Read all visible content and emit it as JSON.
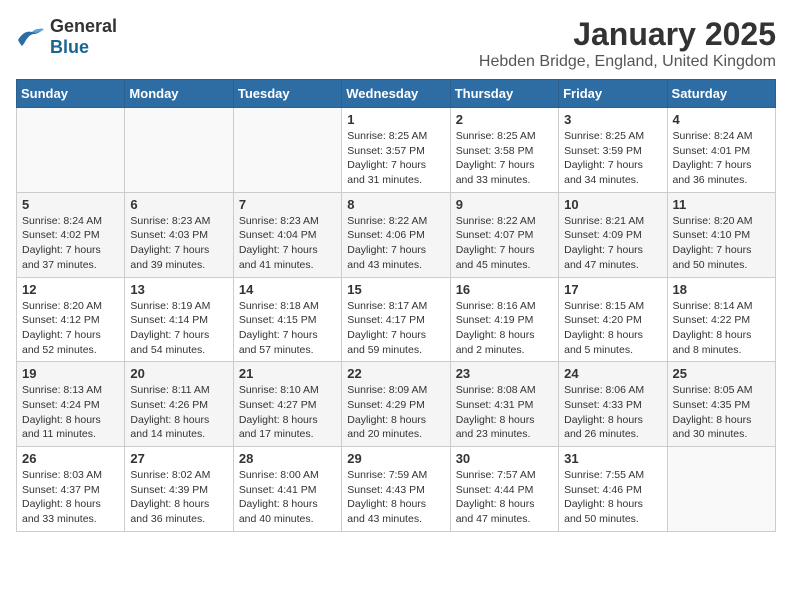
{
  "header": {
    "logo_general": "General",
    "logo_blue": "Blue",
    "month_year": "January 2025",
    "location": "Hebden Bridge, England, United Kingdom"
  },
  "calendar": {
    "days_of_week": [
      "Sunday",
      "Monday",
      "Tuesday",
      "Wednesday",
      "Thursday",
      "Friday",
      "Saturday"
    ],
    "weeks": [
      [
        {
          "day": "",
          "sunrise": "",
          "sunset": "",
          "daylight": ""
        },
        {
          "day": "",
          "sunrise": "",
          "sunset": "",
          "daylight": ""
        },
        {
          "day": "",
          "sunrise": "",
          "sunset": "",
          "daylight": ""
        },
        {
          "day": "1",
          "sunrise": "Sunrise: 8:25 AM",
          "sunset": "Sunset: 3:57 PM",
          "daylight": "Daylight: 7 hours and 31 minutes."
        },
        {
          "day": "2",
          "sunrise": "Sunrise: 8:25 AM",
          "sunset": "Sunset: 3:58 PM",
          "daylight": "Daylight: 7 hours and 33 minutes."
        },
        {
          "day": "3",
          "sunrise": "Sunrise: 8:25 AM",
          "sunset": "Sunset: 3:59 PM",
          "daylight": "Daylight: 7 hours and 34 minutes."
        },
        {
          "day": "4",
          "sunrise": "Sunrise: 8:24 AM",
          "sunset": "Sunset: 4:01 PM",
          "daylight": "Daylight: 7 hours and 36 minutes."
        }
      ],
      [
        {
          "day": "5",
          "sunrise": "Sunrise: 8:24 AM",
          "sunset": "Sunset: 4:02 PM",
          "daylight": "Daylight: 7 hours and 37 minutes."
        },
        {
          "day": "6",
          "sunrise": "Sunrise: 8:23 AM",
          "sunset": "Sunset: 4:03 PM",
          "daylight": "Daylight: 7 hours and 39 minutes."
        },
        {
          "day": "7",
          "sunrise": "Sunrise: 8:23 AM",
          "sunset": "Sunset: 4:04 PM",
          "daylight": "Daylight: 7 hours and 41 minutes."
        },
        {
          "day": "8",
          "sunrise": "Sunrise: 8:22 AM",
          "sunset": "Sunset: 4:06 PM",
          "daylight": "Daylight: 7 hours and 43 minutes."
        },
        {
          "day": "9",
          "sunrise": "Sunrise: 8:22 AM",
          "sunset": "Sunset: 4:07 PM",
          "daylight": "Daylight: 7 hours and 45 minutes."
        },
        {
          "day": "10",
          "sunrise": "Sunrise: 8:21 AM",
          "sunset": "Sunset: 4:09 PM",
          "daylight": "Daylight: 7 hours and 47 minutes."
        },
        {
          "day": "11",
          "sunrise": "Sunrise: 8:20 AM",
          "sunset": "Sunset: 4:10 PM",
          "daylight": "Daylight: 7 hours and 50 minutes."
        }
      ],
      [
        {
          "day": "12",
          "sunrise": "Sunrise: 8:20 AM",
          "sunset": "Sunset: 4:12 PM",
          "daylight": "Daylight: 7 hours and 52 minutes."
        },
        {
          "day": "13",
          "sunrise": "Sunrise: 8:19 AM",
          "sunset": "Sunset: 4:14 PM",
          "daylight": "Daylight: 7 hours and 54 minutes."
        },
        {
          "day": "14",
          "sunrise": "Sunrise: 8:18 AM",
          "sunset": "Sunset: 4:15 PM",
          "daylight": "Daylight: 7 hours and 57 minutes."
        },
        {
          "day": "15",
          "sunrise": "Sunrise: 8:17 AM",
          "sunset": "Sunset: 4:17 PM",
          "daylight": "Daylight: 7 hours and 59 minutes."
        },
        {
          "day": "16",
          "sunrise": "Sunrise: 8:16 AM",
          "sunset": "Sunset: 4:19 PM",
          "daylight": "Daylight: 8 hours and 2 minutes."
        },
        {
          "day": "17",
          "sunrise": "Sunrise: 8:15 AM",
          "sunset": "Sunset: 4:20 PM",
          "daylight": "Daylight: 8 hours and 5 minutes."
        },
        {
          "day": "18",
          "sunrise": "Sunrise: 8:14 AM",
          "sunset": "Sunset: 4:22 PM",
          "daylight": "Daylight: 8 hours and 8 minutes."
        }
      ],
      [
        {
          "day": "19",
          "sunrise": "Sunrise: 8:13 AM",
          "sunset": "Sunset: 4:24 PM",
          "daylight": "Daylight: 8 hours and 11 minutes."
        },
        {
          "day": "20",
          "sunrise": "Sunrise: 8:11 AM",
          "sunset": "Sunset: 4:26 PM",
          "daylight": "Daylight: 8 hours and 14 minutes."
        },
        {
          "day": "21",
          "sunrise": "Sunrise: 8:10 AM",
          "sunset": "Sunset: 4:27 PM",
          "daylight": "Daylight: 8 hours and 17 minutes."
        },
        {
          "day": "22",
          "sunrise": "Sunrise: 8:09 AM",
          "sunset": "Sunset: 4:29 PM",
          "daylight": "Daylight: 8 hours and 20 minutes."
        },
        {
          "day": "23",
          "sunrise": "Sunrise: 8:08 AM",
          "sunset": "Sunset: 4:31 PM",
          "daylight": "Daylight: 8 hours and 23 minutes."
        },
        {
          "day": "24",
          "sunrise": "Sunrise: 8:06 AM",
          "sunset": "Sunset: 4:33 PM",
          "daylight": "Daylight: 8 hours and 26 minutes."
        },
        {
          "day": "25",
          "sunrise": "Sunrise: 8:05 AM",
          "sunset": "Sunset: 4:35 PM",
          "daylight": "Daylight: 8 hours and 30 minutes."
        }
      ],
      [
        {
          "day": "26",
          "sunrise": "Sunrise: 8:03 AM",
          "sunset": "Sunset: 4:37 PM",
          "daylight": "Daylight: 8 hours and 33 minutes."
        },
        {
          "day": "27",
          "sunrise": "Sunrise: 8:02 AM",
          "sunset": "Sunset: 4:39 PM",
          "daylight": "Daylight: 8 hours and 36 minutes."
        },
        {
          "day": "28",
          "sunrise": "Sunrise: 8:00 AM",
          "sunset": "Sunset: 4:41 PM",
          "daylight": "Daylight: 8 hours and 40 minutes."
        },
        {
          "day": "29",
          "sunrise": "Sunrise: 7:59 AM",
          "sunset": "Sunset: 4:43 PM",
          "daylight": "Daylight: 8 hours and 43 minutes."
        },
        {
          "day": "30",
          "sunrise": "Sunrise: 7:57 AM",
          "sunset": "Sunset: 4:44 PM",
          "daylight": "Daylight: 8 hours and 47 minutes."
        },
        {
          "day": "31",
          "sunrise": "Sunrise: 7:55 AM",
          "sunset": "Sunset: 4:46 PM",
          "daylight": "Daylight: 8 hours and 50 minutes."
        },
        {
          "day": "",
          "sunrise": "",
          "sunset": "",
          "daylight": ""
        }
      ]
    ]
  }
}
